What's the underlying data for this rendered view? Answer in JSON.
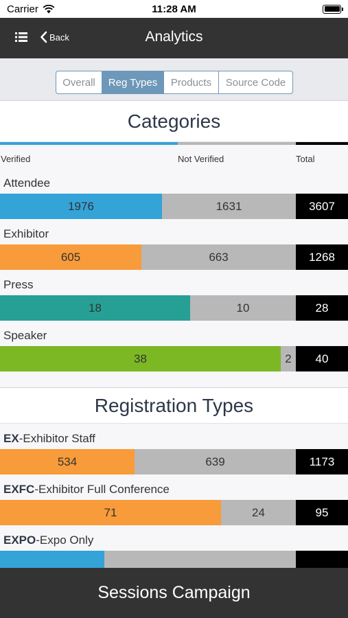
{
  "status_bar": {
    "carrier": "Carrier",
    "time": "11:28 AM"
  },
  "nav": {
    "back_label": "Back",
    "title": "Analytics"
  },
  "segments": [
    {
      "label": "Overall",
      "active": false
    },
    {
      "label": "Reg Types",
      "active": true
    },
    {
      "label": "Products",
      "active": false
    },
    {
      "label": "Source Code",
      "active": false
    }
  ],
  "categories": {
    "title": "Categories",
    "legend": {
      "verified": "Verified",
      "not_verified": "Not Verified",
      "total": "Total"
    },
    "rows": [
      {
        "label": "Attendee",
        "verified": "1976",
        "not_verified": "1631",
        "total": "3607",
        "color": "#34a3d8"
      },
      {
        "label": "Exhibitor",
        "verified": "605",
        "not_verified": "663",
        "total": "1268",
        "color": "#f89b3a"
      },
      {
        "label": "Press",
        "verified": "18",
        "not_verified": "10",
        "total": "28",
        "color": "#26a095"
      },
      {
        "label": "Speaker",
        "verified": "38",
        "not_verified": "2",
        "total": "40",
        "color": "#7cb824"
      }
    ]
  },
  "registration_types": {
    "title": "Registration Types",
    "rows": [
      {
        "code": "EX",
        "name": "-Exhibitor Staff",
        "verified": "534",
        "not_verified": "639",
        "total": "1173",
        "color": "#f89b3a"
      },
      {
        "code": "EXFC",
        "name": "-Exhibitor Full Conference",
        "verified": "71",
        "not_verified": "24",
        "total": "95",
        "color": "#f89b3a"
      },
      {
        "code": "EXPO",
        "name": "-Expo Only",
        "verified": "",
        "not_verified": "",
        "total": "",
        "color": "#34a3d8"
      }
    ]
  },
  "bottom_bar": {
    "label": "Sessions Campaign"
  },
  "colors": {
    "nav_bg": "#333333",
    "segment_active": "#6d98b9",
    "not_verified": "#b8b8b8",
    "total_bg": "#000000"
  }
}
